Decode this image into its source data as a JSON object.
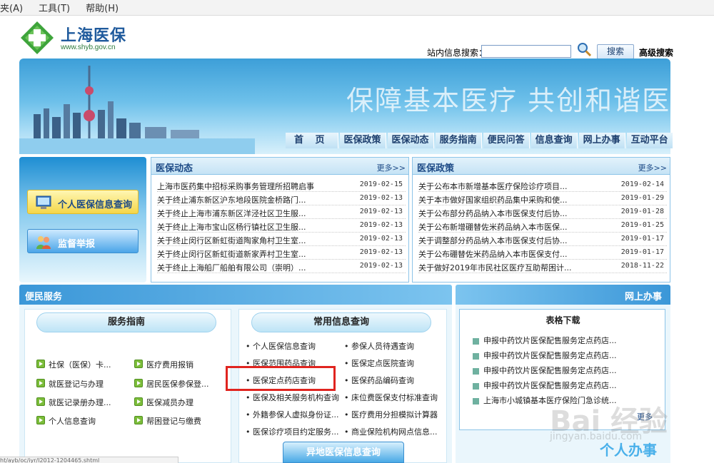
{
  "browser": {
    "menu": [
      "夹(A)",
      "工具(T)",
      "帮助(H)"
    ],
    "status": "ht/ayb/oc/iyr/l2012-1204465.shtml"
  },
  "header": {
    "logo_title": "上海医保",
    "logo_url": "www.shyb.gov.cn",
    "search_label": "站内信息搜索：",
    "search_value": "",
    "search_button": "搜索",
    "advanced_search": "高级搜索"
  },
  "banner": {
    "slogan": "保障基本医疗  共创和谐医保",
    "nav": [
      "首 页",
      "医保政策",
      "医保动态",
      "服务指南",
      "便民问答",
      "信息查询",
      "网上办事",
      "互动平台"
    ]
  },
  "left_panel": {
    "personal_query": "个人医保信息查询",
    "supervise": "监督举报"
  },
  "news": {
    "title": "医保动态",
    "more": "更多>>",
    "items": [
      {
        "title": "上海市医药集中招标采购事务管理所招聘启事",
        "date": "2019-02-15"
      },
      {
        "title": "关于终止浦东新区沪东地段医院金桥路门...",
        "date": "2019-02-13"
      },
      {
        "title": "关于终止上海市浦东新区洋泾社区卫生服...",
        "date": "2019-02-13"
      },
      {
        "title": "关于终止上海市宝山区杨行镇社区卫生服...",
        "date": "2019-02-13"
      },
      {
        "title": "关于终止闵行区新虹街道陶家角村卫生室...",
        "date": "2019-02-13"
      },
      {
        "title": "关于终止闵行区新虹街道新家弄村卫生室...",
        "date": "2019-02-13"
      },
      {
        "title": "关于终止上海船厂船舶有限公司（崇明）...",
        "date": "2019-02-13"
      }
    ]
  },
  "policy": {
    "title": "医保政策",
    "more": "更多>>",
    "items": [
      {
        "title": "关于公布本市新增基本医疗保险诊疗项目...",
        "date": "2019-02-14"
      },
      {
        "title": "关于本市做好国家组织药品集中采购和使...",
        "date": "2019-01-29"
      },
      {
        "title": "关于公布部分药品纳入本市医保支付后协...",
        "date": "2019-01-28"
      },
      {
        "title": "关于公布新增硼替佐米药品纳入本市医保...",
        "date": "2019-01-25"
      },
      {
        "title": "关于调整部分药品纳入本市医保支付后协...",
        "date": "2019-01-17"
      },
      {
        "title": "关于公布硼替佐米药品纳入本市医保支付...",
        "date": "2019-01-17"
      },
      {
        "title": "关于做好2019年市民社区医疗互助帮困计...",
        "date": "2018-11-22"
      }
    ]
  },
  "service": {
    "title": "便民服务",
    "guide_title": "服务指南",
    "guide_items": [
      [
        "社保（医保）卡...",
        "医疗费用报销"
      ],
      [
        "就医登记与办理",
        "居民医保参保登..."
      ],
      [
        "就医记录册办理...",
        "医保减员办理"
      ],
      [
        "个人信息查询",
        "帮困登记与缴费"
      ]
    ],
    "query_title": "常用信息查询",
    "query_items": [
      [
        "个人医保信息查询",
        "参保人员待遇查询"
      ],
      [
        "医保范围药品查询",
        "医保定点医院查询"
      ],
      [
        "医保定点药店查询",
        "医保药品编码查询"
      ],
      [
        "医保及相关服务机构查询",
        "床位费医保支付标准查询"
      ],
      [
        "外籍参保人虚拟身份证...",
        "医疗费用分担模拟计算器"
      ],
      [
        "医保诊疗项目约定服务...",
        "商业保险机构网点信息..."
      ]
    ],
    "remote_query": "异地医保信息查询"
  },
  "online": {
    "title": "网上办事",
    "forms_title": "表格下载",
    "forms": [
      "申报中药饮片医保配售服务定点药店...",
      "申报中药饮片医保配售服务定点药店...",
      "申报中药饮片医保配售服务定点药店...",
      "申报中药饮片医保配售服务定点药店...",
      "上海市小城镇基本医疗保险门急诊统..."
    ],
    "more": "更多",
    "personal_office": "个人办事"
  },
  "watermark": {
    "main": "Bai 经验",
    "sub": "jingyan.baidu.com"
  },
  "colors": {
    "accent": "#1d4a86",
    "highlight": "#e0241f"
  }
}
